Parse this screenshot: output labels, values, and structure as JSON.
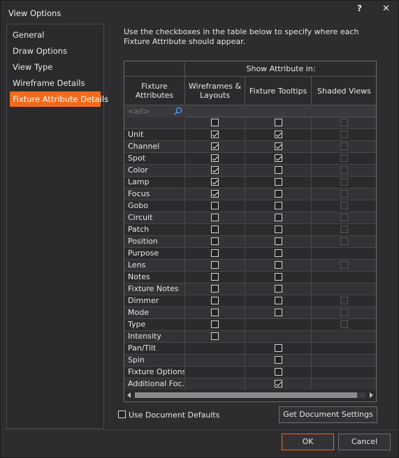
{
  "window": {
    "title": "View Options",
    "help": "?",
    "close": "✕"
  },
  "sidebar": {
    "items": [
      {
        "label": "General"
      },
      {
        "label": "Draw Options"
      },
      {
        "label": "View Type"
      },
      {
        "label": "Wireframe Details"
      },
      {
        "label": "Fixture Attribute Details",
        "active": true
      }
    ]
  },
  "description": "Use the checkboxes in the table below to specify where each Fixture Attribute should appear.",
  "table": {
    "group_header": "Show Attribute in:",
    "col_name": "Fixture Attributes",
    "columns": [
      "Wireframes & Layouts",
      "Fixture Tooltips",
      "Shaded Views"
    ],
    "filter_placeholder": "<all>",
    "rows": [
      {
        "name": "",
        "cells": [
          "unchecked",
          "unchecked",
          "disabled"
        ]
      },
      {
        "name": "Unit",
        "cells": [
          "checked",
          "checked",
          "disabled"
        ]
      },
      {
        "name": "Channel",
        "cells": [
          "checked",
          "checked",
          "disabled"
        ]
      },
      {
        "name": "Spot",
        "cells": [
          "checked",
          "checked",
          "disabled"
        ]
      },
      {
        "name": "Color",
        "cells": [
          "checked",
          "unchecked",
          "disabled"
        ]
      },
      {
        "name": "Lamp",
        "cells": [
          "checked",
          "unchecked",
          "disabled"
        ]
      },
      {
        "name": "Focus",
        "cells": [
          "checked",
          "unchecked",
          "disabled"
        ]
      },
      {
        "name": "Gobo",
        "cells": [
          "unchecked",
          "unchecked",
          "disabled"
        ]
      },
      {
        "name": "Circuit",
        "cells": [
          "unchecked",
          "unchecked",
          "disabled"
        ]
      },
      {
        "name": "Patch",
        "cells": [
          "unchecked",
          "unchecked",
          "disabled"
        ]
      },
      {
        "name": "Position",
        "cells": [
          "unchecked",
          "unchecked",
          "disabled"
        ]
      },
      {
        "name": "Purpose",
        "cells": [
          "unchecked",
          "unchecked",
          "none"
        ]
      },
      {
        "name": "Lens",
        "cells": [
          "unchecked",
          "unchecked",
          "disabled"
        ]
      },
      {
        "name": "Notes",
        "cells": [
          "unchecked",
          "unchecked",
          "none"
        ]
      },
      {
        "name": "Fixture Notes",
        "cells": [
          "unchecked",
          "unchecked",
          "none"
        ]
      },
      {
        "name": "Dimmer",
        "cells": [
          "unchecked",
          "unchecked",
          "disabled"
        ]
      },
      {
        "name": "Mode",
        "cells": [
          "unchecked",
          "unchecked",
          "disabled"
        ]
      },
      {
        "name": "Type",
        "cells": [
          "unchecked",
          "none",
          "disabled"
        ]
      },
      {
        "name": "Intensity",
        "cells": [
          "unchecked",
          "none",
          "none"
        ]
      },
      {
        "name": "Pan/Tilt",
        "cells": [
          "none",
          "unchecked",
          "none"
        ]
      },
      {
        "name": "Spin",
        "cells": [
          "none",
          "unchecked",
          "none"
        ]
      },
      {
        "name": "Fixture Options",
        "cells": [
          "none",
          "unchecked",
          "none"
        ]
      },
      {
        "name": "Additional Foc...",
        "cells": [
          "none",
          "checked",
          "none"
        ]
      }
    ]
  },
  "use_document_defaults": {
    "label": "Use Document Defaults",
    "checked": false
  },
  "buttons": {
    "get_settings": "Get Document Settings",
    "ok": "OK",
    "cancel": "Cancel"
  },
  "colors": {
    "accent": "#f26a1b",
    "background": "#2d2d30"
  }
}
